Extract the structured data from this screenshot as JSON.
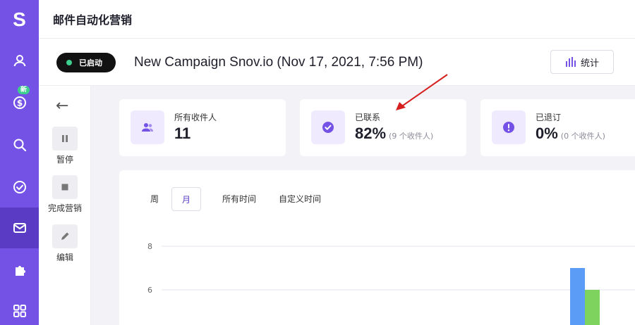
{
  "app": {
    "logo": "S",
    "page_title": "邮件自动化营销"
  },
  "sidebar": {
    "badge_new": "新",
    "items": [
      {
        "name": "person-icon"
      },
      {
        "name": "dollar-icon"
      },
      {
        "name": "search-icon"
      },
      {
        "name": "check-circle-icon"
      },
      {
        "name": "mail-icon",
        "active": true
      },
      {
        "name": "puzzle-icon"
      },
      {
        "name": "grid-icon"
      }
    ]
  },
  "campaign": {
    "status": "已启动",
    "title": "New Campaign Snov.io (Nov 17, 2021, 7:56 PM)",
    "stats_button": "统计"
  },
  "actions": [
    {
      "label": "暂停",
      "icon": "pause-icon"
    },
    {
      "label": "完成营销",
      "icon": "stop-icon"
    },
    {
      "label": "编辑",
      "icon": "pencil-icon"
    }
  ],
  "cards": [
    {
      "label": "所有收件人",
      "value": "11",
      "sub": "",
      "icon": "users-icon"
    },
    {
      "label": "已联系",
      "value": "82%",
      "sub": "(9 个收件人)",
      "icon": "check-icon"
    },
    {
      "label": "已退订",
      "value": "0%",
      "sub": "(0 个收件人)",
      "icon": "exclamation-icon"
    }
  ],
  "range_tabs": [
    "周",
    "月",
    "所有时间",
    "自定义时间"
  ],
  "colors": {
    "accent": "#7552e6",
    "accent_dark": "#5a3bc4",
    "bar_blue": "#5b9cf6",
    "bar_green": "#7dd35e",
    "annotation": "#d62020"
  },
  "chart_data": {
    "type": "bar",
    "ytick_labels": [
      "8",
      "6"
    ],
    "ylim": [
      0,
      8
    ],
    "series": [
      {
        "values": [
          7
        ],
        "color": "#5b9cf6"
      },
      {
        "values": [
          6
        ],
        "color": "#7dd35e"
      }
    ]
  }
}
